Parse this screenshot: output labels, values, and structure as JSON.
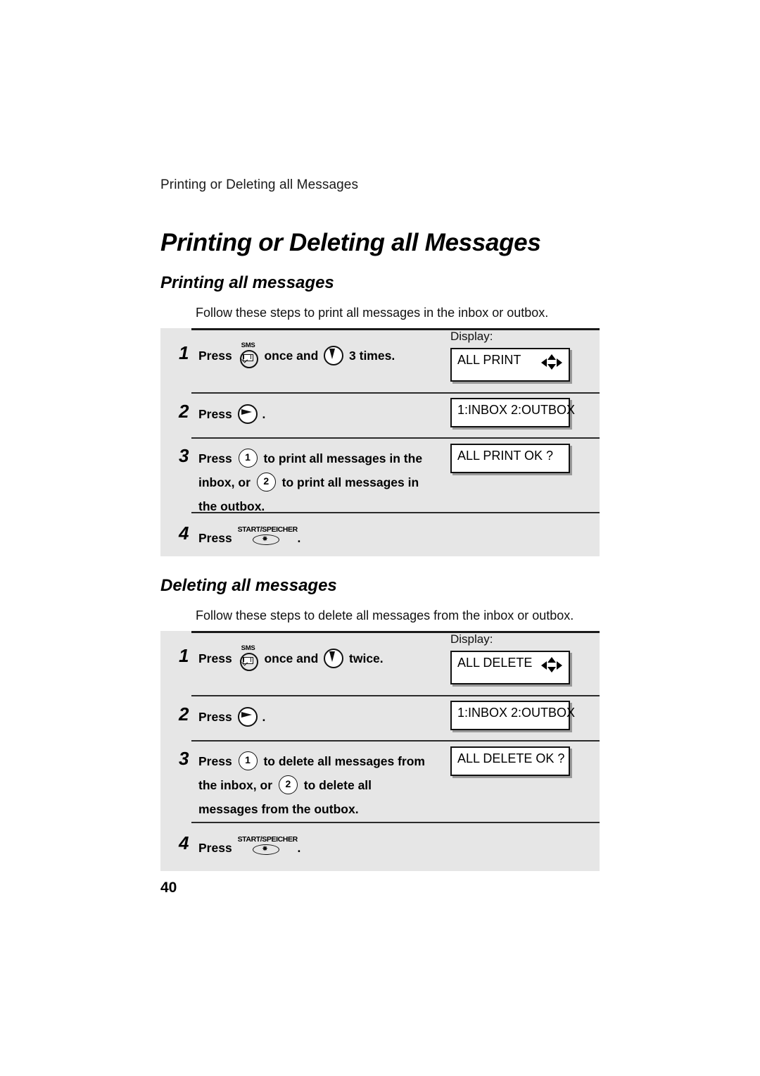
{
  "page": {
    "running_header": "Printing or Deleting all Messages",
    "chapter_title": "Printing or Deleting all Messages",
    "page_number": "40"
  },
  "sections": [
    {
      "id": "print",
      "title": "Printing all messages",
      "intro": "Follow these steps to print all messages in the inbox or outbox.",
      "display_label": "Display:",
      "steps": [
        {
          "number": "1",
          "text_before": "Press",
          "key1": "sms-key",
          "text_mid": "once and",
          "key2": "down-arrow-key",
          "text_after": "3 times.",
          "display": "ALL PRINT",
          "display_has_arrows": true
        },
        {
          "number": "2",
          "text_before": "Press",
          "key1": "enter-arrow-key",
          "text_after": ".",
          "display": "1:INBOX 2:OUTBOX",
          "display_has_arrows": false
        },
        {
          "number": "3",
          "text_before": "Press",
          "key1": "number-key-1",
          "key1_label": "1",
          "text_mid": "to print all messages in the",
          "line2_before": "inbox, or",
          "key2": "number-key-2",
          "key2_label": "2",
          "line2_after": "to print all messages in",
          "line3": "the outbox.",
          "display": "ALL PRINT OK ?",
          "display_has_arrows": false
        },
        {
          "number": "4",
          "text_before": "Press",
          "key1": "start-speicher-key",
          "key1_label": "START/SPEICHER",
          "text_after": ".",
          "display": "",
          "display_has_arrows": false
        }
      ]
    },
    {
      "id": "delete",
      "title": "Deleting all messages",
      "intro": "Follow these steps to delete all messages from the inbox or outbox.",
      "display_label": "Display:",
      "steps": [
        {
          "number": "1",
          "text_before": "Press",
          "key1": "sms-key",
          "text_mid": "once and",
          "key2": "down-arrow-key",
          "text_after": "twice.",
          "display": "ALL DELETE",
          "display_has_arrows": true
        },
        {
          "number": "2",
          "text_before": "Press",
          "key1": "enter-arrow-key",
          "text_after": ".",
          "display": "1:INBOX 2:OUTBOX",
          "display_has_arrows": false
        },
        {
          "number": "3",
          "text_before": "Press",
          "key1": "number-key-1",
          "key1_label": "1",
          "text_mid": "to delete all messages from",
          "line2_before": "the inbox, or",
          "key2": "number-key-2",
          "key2_label": "2",
          "line2_after": "to delete all",
          "line3": "messages from the outbox.",
          "display": "ALL DELETE OK ?",
          "display_has_arrows": false
        },
        {
          "number": "4",
          "text_before": "Press",
          "key1": "start-speicher-key",
          "key1_label": "START/SPEICHER",
          "text_after": ".",
          "display": "",
          "display_has_arrows": false
        }
      ]
    }
  ],
  "icons": {
    "sms_label": "SMS",
    "start_speicher_label": "START/SPEICHER",
    "start_speicher_glyph": "⭐"
  },
  "colors": {
    "panel_background": "#e6e6e6",
    "page_background": "#ffffff",
    "text": "#000000",
    "rule": "#1a1a1a",
    "display_shadow": "#9a9a9a"
  }
}
